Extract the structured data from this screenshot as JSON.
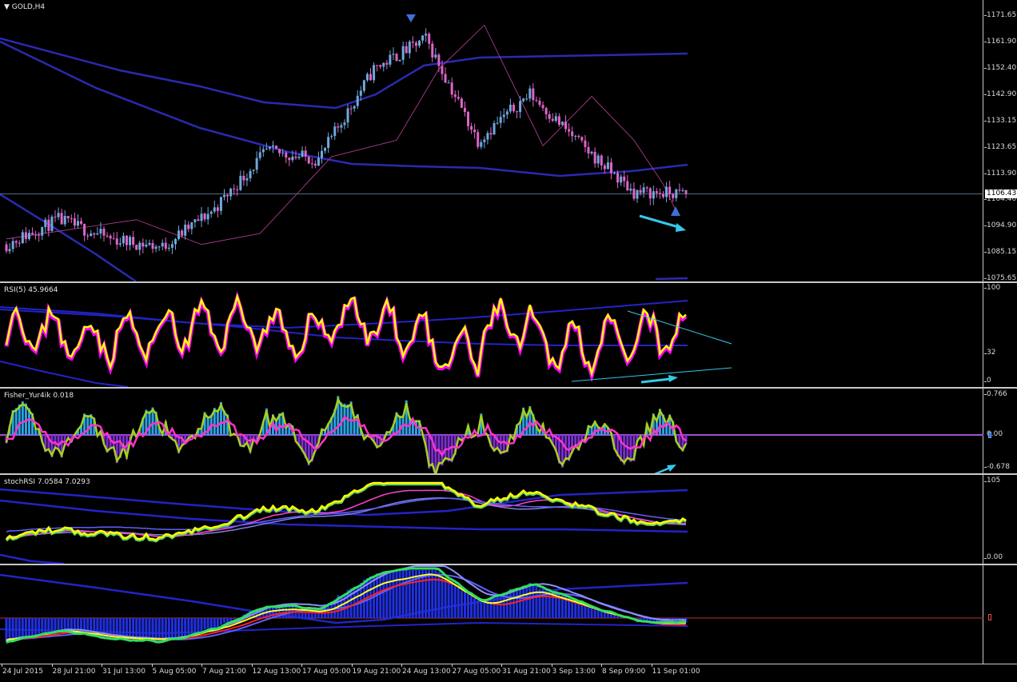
{
  "chart": {
    "symbol_label": "GOLD,H4",
    "current_price": "1106.43",
    "price_ticks": [
      "1171.65",
      "1161.90",
      "1152.40",
      "1142.90",
      "1133.15",
      "1123.65",
      "1113.90",
      "1104.40",
      "1094.90",
      "1085.15",
      "1075.65"
    ],
    "x_labels": [
      "24 Jul 2015",
      "28 Jul 21:00",
      "31 Jul 13:00",
      "5 Aug 05:00",
      "7 Aug 21:00",
      "12 Aug 13:00",
      "17 Aug 05:00",
      "19 Aug 21:00",
      "24 Aug 13:00",
      "27 Aug 05:00",
      "31 Aug 21:00",
      "3 Sep 13:00",
      "8 Sep 09:00",
      "11 Sep 01:00"
    ]
  },
  "indicators": {
    "rsi": {
      "label": "RSI(5) 45.9664",
      "ticks": [
        "100",
        "32",
        "0"
      ]
    },
    "fisher": {
      "label": "Fisher_Yur4ik 0.018",
      "ticks": [
        "0.766",
        "0.00",
        "-0.678"
      ]
    },
    "stochrsi": {
      "label": "stochRSI 7.0584 7.0293",
      "ticks": [
        "105",
        "0.00"
      ]
    },
    "bottom": {
      "label": ""
    }
  },
  "colors": {
    "background": "#000000",
    "candle_up": "#6fa8dc",
    "candle_down": "#e064c8",
    "envelope": "#2a2ab0",
    "rsi_line": "#ffff00",
    "rsi_shadow": "#ff00ff",
    "fisher_bars": "#29a3e0",
    "fisher_neg_bars": "#7b2fd0",
    "fisher_line": "#a6d11e",
    "fisher_signal": "#ff33cc",
    "divergence_arrow": "#35c8e8",
    "grid": "#c8c8c8"
  },
  "chart_data": [
    {
      "type": "line",
      "title": "GOLD,H4",
      "xlabel": "",
      "ylabel": "",
      "ylim": [
        1075.65,
        1171.65
      ],
      "categories": [
        "24 Jul 2015",
        "28 Jul 21:00",
        "31 Jul 13:00",
        "5 Aug 05:00",
        "7 Aug 21:00",
        "12 Aug 13:00",
        "17 Aug 05:00",
        "19 Aug 21:00",
        "24 Aug 13:00",
        "27 Aug 05:00",
        "31 Aug 21:00",
        "3 Sep 13:00",
        "8 Sep 09:00",
        "11 Sep 01:00"
      ],
      "series": [
        {
          "values": [
            1088,
            1097,
            1090,
            1087,
            1101,
            1122,
            1119,
            1152,
            1163,
            1126,
            1143,
            1124,
            1107,
            1106.43
          ]
        }
      ]
    }
  ]
}
